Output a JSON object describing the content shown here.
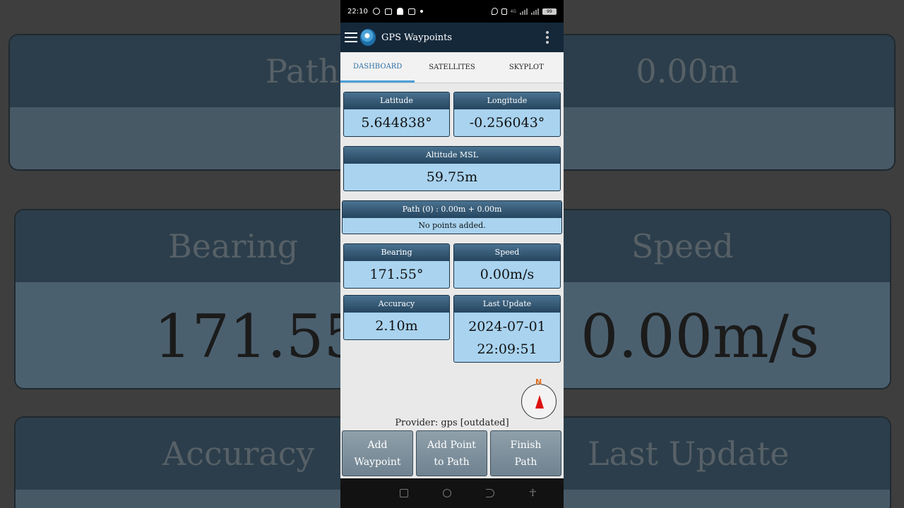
{
  "status_bar": {
    "time": "22:10",
    "net_label": "4G",
    "battery": "99"
  },
  "app": {
    "title": "GPS Waypoints"
  },
  "tabs": [
    {
      "label": "DASHBOARD",
      "active": true
    },
    {
      "label": "SATELLITES",
      "active": false
    },
    {
      "label": "SKYPLOT",
      "active": false
    }
  ],
  "cards": {
    "latitude": {
      "label": "Latitude",
      "value": "5.644838°"
    },
    "longitude": {
      "label": "Longitude",
      "value": "-0.256043°"
    },
    "altitude": {
      "label": "Altitude MSL",
      "value": "59.75m"
    },
    "path": {
      "label": "Path (0) : 0.00m + 0.00m",
      "value": "No points added."
    },
    "bearing": {
      "label": "Bearing",
      "value": "171.55°"
    },
    "speed": {
      "label": "Speed",
      "value": "0.00m/s"
    },
    "accuracy": {
      "label": "Accuracy",
      "value": "2.10m"
    },
    "last_update": {
      "label": "Last Update",
      "date": "2024-07-01",
      "time": "22:09:51"
    }
  },
  "compass": {
    "north_label": "N"
  },
  "provider": {
    "text": "Provider: gps [outdated]"
  },
  "buttons": {
    "add_waypoint": "Add\nWaypoint",
    "add_point_to_path": "Add Point\nto Path",
    "finish_path": "Finish\nPath"
  },
  "background": {
    "path_label": "Path",
    "path_value": "0.00m",
    "bearing_label": "Bearing",
    "bearing_value": "171.55°",
    "speed_label": "Speed",
    "speed_value": "0.00m/s",
    "accuracy_label": "Accuracy",
    "last_update_label": "Last Update"
  },
  "colors": {
    "app_bar": "#14283a",
    "card_head": "#2f5472",
    "card_body": "#a9d3ef",
    "tab_active": "#4a9fd8",
    "compass_needle": "#dd1111"
  }
}
